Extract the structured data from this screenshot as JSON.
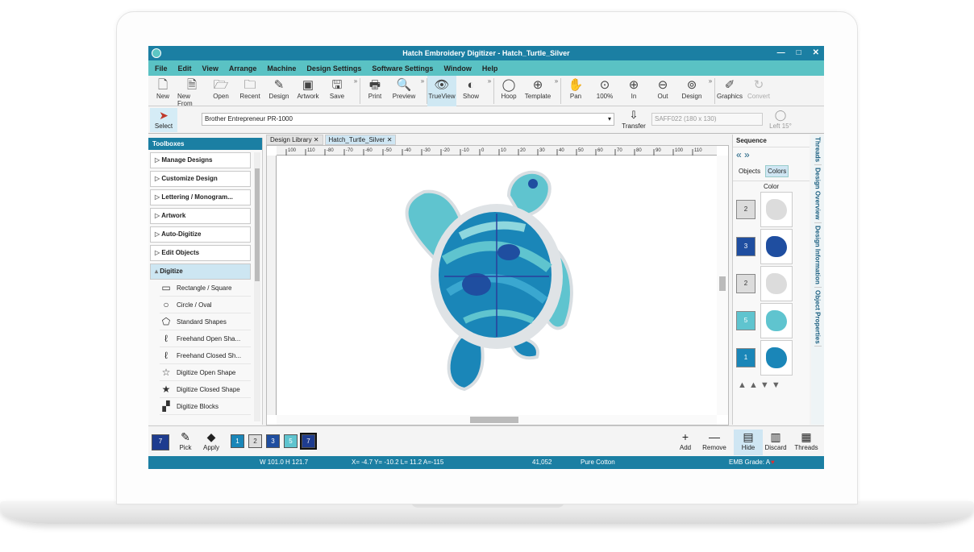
{
  "window": {
    "title": "Hatch Embroidery Digitizer - Hatch_Turtle_Silver",
    "min": "—",
    "max": "□",
    "close": "✕"
  },
  "menu": [
    "File",
    "Edit",
    "View",
    "Arrange",
    "Machine",
    "Design Settings",
    "Software Settings",
    "Window",
    "Help"
  ],
  "toolbar": [
    {
      "label": "New",
      "icon": "new-icon"
    },
    {
      "label": "New From",
      "icon": "new-from-icon"
    },
    {
      "label": "Open",
      "icon": "open-folder-icon"
    },
    {
      "label": "Recent",
      "icon": "recent-icon"
    },
    {
      "label": "Design",
      "icon": "design-icon"
    },
    {
      "label": "Artwork",
      "icon": "artwork-icon"
    },
    {
      "label": "Save",
      "icon": "save-icon"
    },
    {
      "label": "Print",
      "icon": "print-icon"
    },
    {
      "label": "Preview",
      "icon": "preview-icon"
    },
    {
      "label": "TrueView",
      "icon": "trueview-icon"
    },
    {
      "label": "Show",
      "icon": "show-icon"
    },
    {
      "label": "Hoop",
      "icon": "hoop-icon"
    },
    {
      "label": "Template",
      "icon": "template-icon"
    },
    {
      "label": "Pan",
      "icon": "pan-hand-icon"
    },
    {
      "label": "100%",
      "icon": "zoom-100-icon"
    },
    {
      "label": "In",
      "icon": "zoom-in-icon"
    },
    {
      "label": "Out",
      "icon": "zoom-out-icon"
    },
    {
      "label": "Design",
      "icon": "zoom-design-icon"
    },
    {
      "label": "Graphics",
      "icon": "graphics-icon"
    },
    {
      "label": "Convert",
      "icon": "convert-icon"
    }
  ],
  "toolbar2": {
    "select": "Select",
    "machine": "Brother Entrepreneur PR-1000",
    "transfer": "Transfer",
    "hoop": "SAFF022 (180 x 130)",
    "hoop_pos": "Left 15°"
  },
  "toolbox": {
    "title": "Toolboxes",
    "categories": [
      "Manage Designs",
      "Customize Design",
      "Lettering / Monogram...",
      "Artwork",
      "Auto-Digitize",
      "Edit Objects",
      "Digitize"
    ],
    "items": [
      "Rectangle / Square",
      "Circle / Oval",
      "Standard Shapes",
      "Freehand Open Sha...",
      "Freehand Closed Sh...",
      "Digitize Open Shape",
      "Digitize Closed Shape",
      "Digitize Blocks"
    ]
  },
  "tabs": [
    "Design Library",
    "Hatch_Turtle_Silver"
  ],
  "ruler": [
    "100",
    "110",
    "-80",
    "-70",
    "-60",
    "-50",
    "-40",
    "-30",
    "-20",
    "-10",
    "0",
    "10",
    "20",
    "30",
    "40",
    "50",
    "60",
    "70",
    "80",
    "90",
    "100",
    "110"
  ],
  "sequence": {
    "title": "Sequence",
    "tab_objects": "Objects",
    "tab_colors": "Colors",
    "column": "Color",
    "rows": [
      {
        "num": "2",
        "color": "#dcdcdc"
      },
      {
        "num": "3",
        "color": "#1f4ea0"
      },
      {
        "num": "2",
        "color": "#dcdcdc"
      },
      {
        "num": "5",
        "color": "#5fc4cf"
      },
      {
        "num": "1",
        "color": "#1a86b8"
      }
    ]
  },
  "side_tabs": [
    "Threads",
    "Design Overview",
    "Design Information",
    "Object Properties"
  ],
  "bottom": {
    "current": "7",
    "pick": "Pick",
    "apply": "Apply",
    "palette": [
      {
        "n": "1",
        "c": "#1a86b8"
      },
      {
        "n": "2",
        "c": "#dcdcdc"
      },
      {
        "n": "3",
        "c": "#1f4ea0"
      },
      {
        "n": "5",
        "c": "#5fc4cf"
      },
      {
        "n": "7",
        "c": "#1e3c8f"
      }
    ],
    "add": "Add",
    "remove": "Remove",
    "hide": "Hide",
    "discard": "Discard",
    "threads": "Threads"
  },
  "status": {
    "size": "W 101.0 H 121.7",
    "coords": "X= -4.7 Y= -10.2 L= 11.2 A=-115",
    "stitches": "41,052",
    "fabric": "Pure Cotton",
    "grade": "EMB Grade: A"
  }
}
